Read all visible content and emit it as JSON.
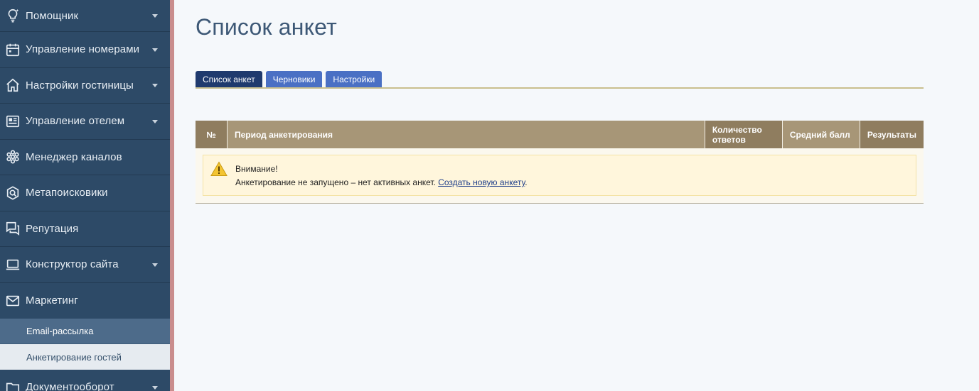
{
  "sidebar": {
    "items": [
      {
        "label": "Помощник",
        "icon": "lightbulb-icon",
        "has_children": true
      },
      {
        "label": "Управление номерами",
        "icon": "calendar-icon",
        "has_children": true
      },
      {
        "label": "Настройки гостиницы",
        "icon": "home-icon",
        "has_children": true
      },
      {
        "label": "Управление отелем",
        "icon": "dashboard-icon",
        "has_children": true
      },
      {
        "label": "Менеджер каналов",
        "icon": "network-icon",
        "has_children": false
      },
      {
        "label": "Метапоисковики",
        "icon": "search-gear-icon",
        "has_children": false
      },
      {
        "label": "Репутация",
        "icon": "chat-icon",
        "has_children": false
      },
      {
        "label": "Конструктор сайта",
        "icon": "laptop-icon",
        "has_children": true
      },
      {
        "label": "Маркетинг",
        "icon": "envelope-icon",
        "has_children": false
      }
    ],
    "subitems": [
      {
        "label": "Email-рассылка"
      },
      {
        "label": "Анкетирование гостей"
      }
    ],
    "last_item": {
      "label": "Документооборот",
      "icon": "folder-icon",
      "has_children": true
    }
  },
  "main": {
    "title": "Список анкет",
    "tabs": [
      {
        "label": "Список анкет",
        "active": true
      },
      {
        "label": "Черновики",
        "active": false
      },
      {
        "label": "Настройки",
        "active": false
      }
    ],
    "table": {
      "headers": {
        "num": "№",
        "period": "Период анкетирования",
        "count": "Количество ответов",
        "avg": "Средний балл",
        "results": "Результаты"
      },
      "notice": {
        "title": "Внимание!",
        "text": "Анкетирование не запущено – нет активных анкет. ",
        "link": "Создать новую анкету",
        "suffix": "."
      }
    }
  },
  "colors": {
    "sidebar_bg": "#2d4a67",
    "accent_border": "#c98d8d",
    "tab_active": "#1f3a6e",
    "tab_normal": "#4a70c4",
    "table_header": "#a79677",
    "notice_bg": "#fff6dc"
  }
}
